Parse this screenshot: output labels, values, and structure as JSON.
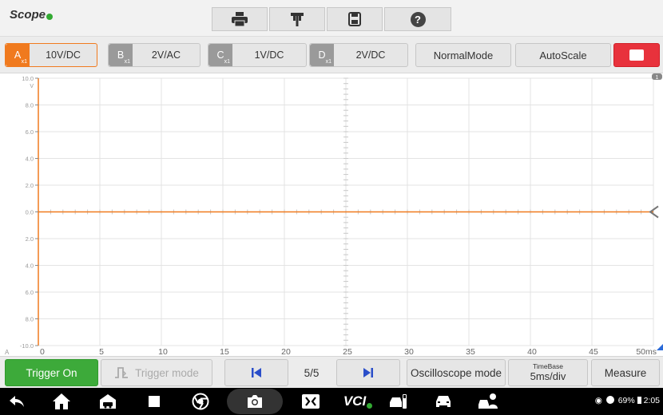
{
  "app": {
    "title": "Scope"
  },
  "toolbar": {
    "icons": [
      "printer-icon",
      "flag-icon",
      "save-icon",
      "help-icon"
    ],
    "help_glyph": "?"
  },
  "channels": [
    {
      "letter": "A",
      "scale": "x1",
      "value": "10V/DC",
      "color": "#f07a1e",
      "active": true
    },
    {
      "letter": "B",
      "scale": "x1",
      "value": "2V/AC",
      "color": "#9a9a9a",
      "active": false
    },
    {
      "letter": "C",
      "scale": "x1",
      "value": "1V/DC",
      "color": "#9a9a9a",
      "active": false
    },
    {
      "letter": "D",
      "scale": "x1",
      "value": "2V/DC",
      "color": "#9a9a9a",
      "active": false
    }
  ],
  "modes": {
    "normal": "NormalMode",
    "autoscale": "AutoScale",
    "stop_color": "#e8323c"
  },
  "graph": {
    "y_ticks": [
      "10.0",
      "8.0",
      "6.0",
      "4.0",
      "2.0",
      "0.0",
      "2.0",
      "4.0",
      "6.0",
      "8.0",
      "-10.0"
    ],
    "y_unit": "V",
    "x_channel": "A",
    "x_ticks": [
      "0",
      "5",
      "10",
      "15",
      "20",
      "25",
      "30",
      "35",
      "40",
      "45",
      "50ms"
    ],
    "badge": "1",
    "trace_color": "#f07a1e",
    "trace_level": 0
  },
  "bottom": {
    "trigger_on": "Trigger On",
    "trigger_mode": "Trigger mode",
    "page": "5/5",
    "oscilloscope_mode": "Oscilloscope mode",
    "timebase_label": "TimeBase",
    "timebase_value": "5ms/div",
    "measure": "Measure",
    "trigger_on_color": "#3daa3a"
  },
  "status": {
    "battery": "69%",
    "time": "2:05"
  },
  "navbar": {
    "vci_label": "VCI"
  }
}
